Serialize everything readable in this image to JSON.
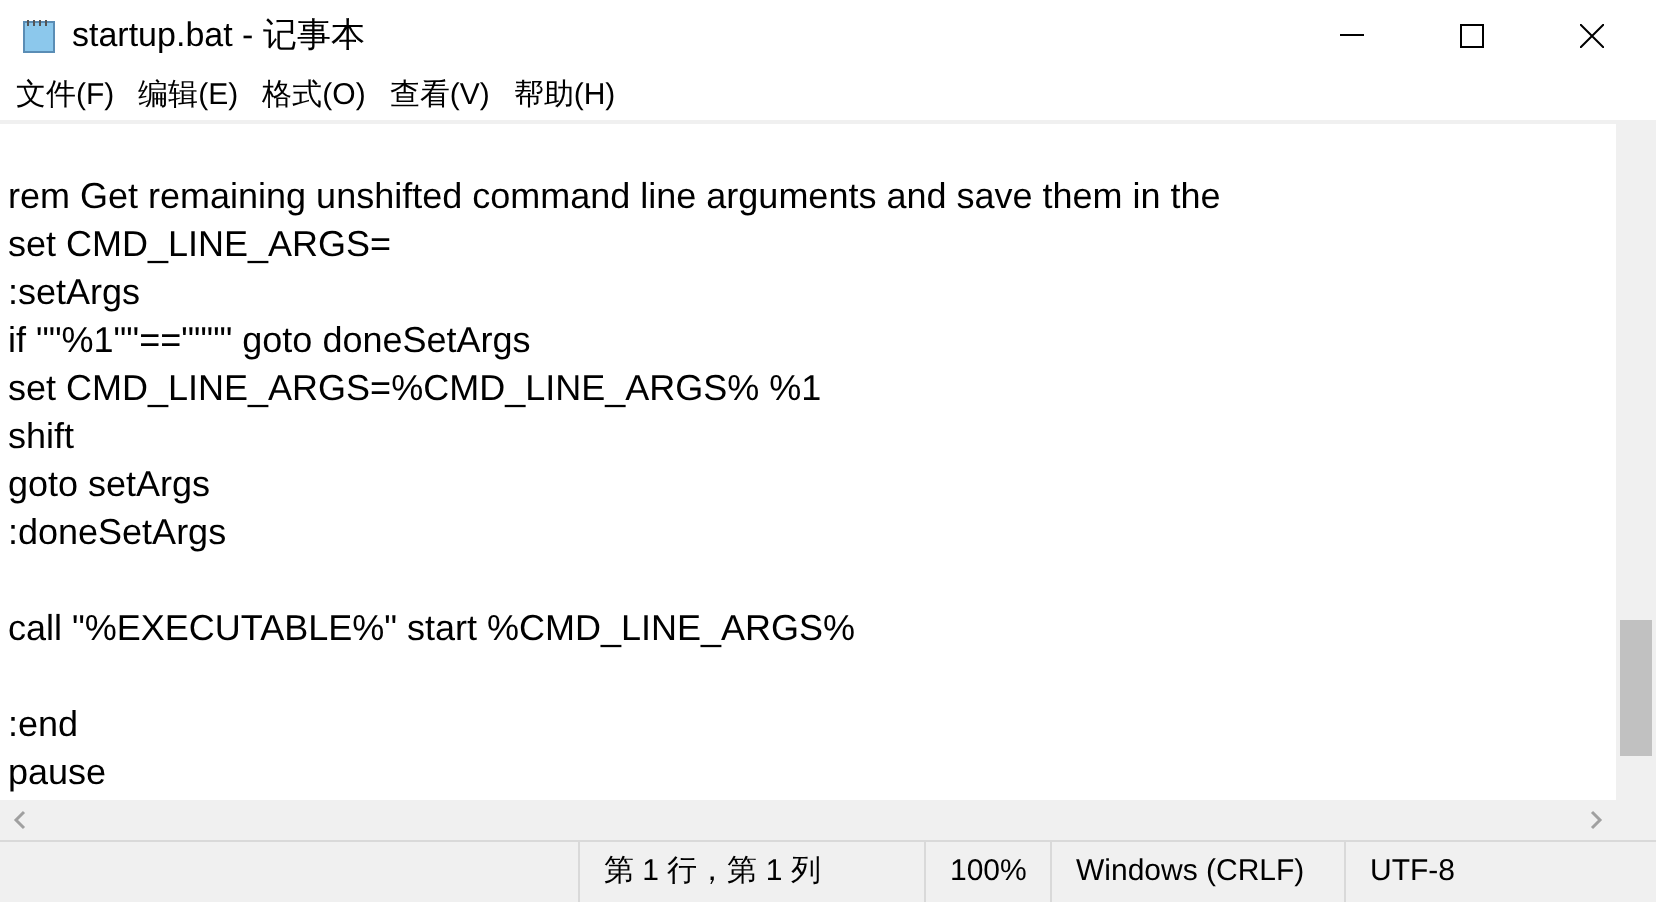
{
  "window": {
    "title": "startup.bat - 记事本"
  },
  "menu": [
    {
      "label": "文件(F)"
    },
    {
      "label": "编辑(E)"
    },
    {
      "label": "格式(O)"
    },
    {
      "label": "查看(V)"
    },
    {
      "label": "帮助(H)"
    }
  ],
  "editor": {
    "text": "rem Get remaining unshifted command line arguments and save them in the\nset CMD_LINE_ARGS=\n:setArgs\nif \"\"%1\"\"==\"\"\"\" goto doneSetArgs\nset CMD_LINE_ARGS=%CMD_LINE_ARGS% %1\nshift\ngoto setArgs\n:doneSetArgs\n\ncall \"%EXECUTABLE%\" start %CMD_LINE_ARGS%\n\n:end\npause"
  },
  "status_bar": [
    "第 1 行，第 1 列",
    "100%",
    "Windows (CRLF)",
    "UTF-8"
  ]
}
